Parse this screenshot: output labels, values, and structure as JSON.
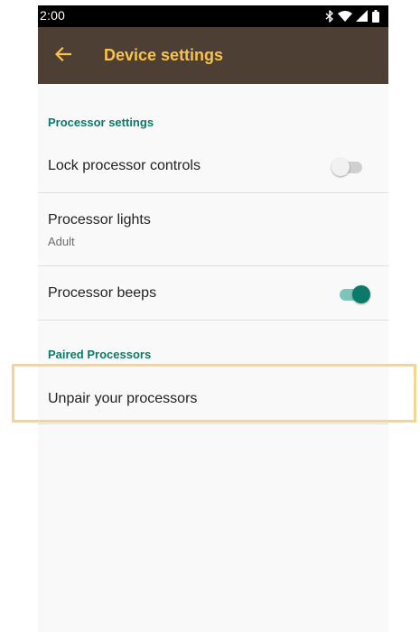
{
  "status_bar": {
    "time": "2:00",
    "icons": [
      "bluetooth-icon",
      "wifi-icon",
      "cellular-signal-icon",
      "battery-icon"
    ]
  },
  "app_bar": {
    "back_icon": "back-arrow-icon",
    "title": "Device settings"
  },
  "sections": {
    "processor_settings": {
      "header": "Processor settings",
      "lock_controls": {
        "label": "Lock processor controls",
        "enabled": false
      },
      "lights": {
        "label": "Processor lights",
        "value": "Adult"
      },
      "beeps": {
        "label": "Processor beeps",
        "enabled": true
      }
    },
    "paired_processors": {
      "header": "Paired Processors",
      "unpair": {
        "label": "Unpair your processors"
      }
    }
  },
  "colors": {
    "app_bar_background": "#4d3f33",
    "title_accent": "#f9c24b",
    "section_header": "#0b7a6a",
    "switch_on": "#0b7a6a",
    "highlight": "#f7d58f"
  }
}
